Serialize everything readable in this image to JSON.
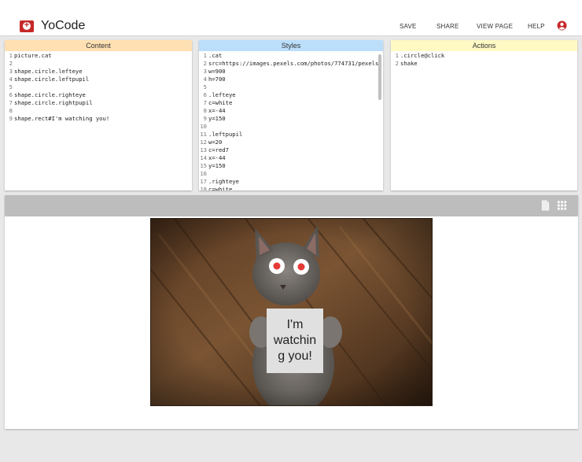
{
  "app": {
    "title": "YoCode"
  },
  "nav": [
    {
      "label": "SAVE"
    },
    {
      "label": "SHARE"
    },
    {
      "label": "VIEW PAGE"
    },
    {
      "label": "HELP"
    }
  ],
  "panels": {
    "content": {
      "title": "Content",
      "color": "#ffe0b2",
      "lines": [
        {
          "n": "1",
          "text": "picture.cat"
        },
        {
          "n": "2",
          "text": ""
        },
        {
          "n": "3",
          "text": "shape.circle.lefteye"
        },
        {
          "n": "4",
          "text": "shape.circle.leftpupil"
        },
        {
          "n": "5",
          "text": ""
        },
        {
          "n": "6",
          "text": "shape.circle.righteye"
        },
        {
          "n": "7",
          "text": "shape.circle.rightpupil"
        },
        {
          "n": "8",
          "text": ""
        },
        {
          "n": "9",
          "text": "shape.rect#I'm watching you!"
        }
      ]
    },
    "styles": {
      "title": "Styles",
      "color": "#bbdefb",
      "lines": [
        {
          "n": "1",
          "text": ".cat"
        },
        {
          "n": "2",
          "text": "src=https://images.pexels.com/photos/774731/pexels"
        },
        {
          "n": "3",
          "text": "w=900"
        },
        {
          "n": "4",
          "text": "h=700"
        },
        {
          "n": "5",
          "text": ""
        },
        {
          "n": "6",
          "text": ".lefteye"
        },
        {
          "n": "7",
          "text": "c=white"
        },
        {
          "n": "8",
          "text": "x=-44"
        },
        {
          "n": "9",
          "text": "y=150"
        },
        {
          "n": "10",
          "text": ""
        },
        {
          "n": "11",
          "text": ".leftpupil"
        },
        {
          "n": "12",
          "text": "w=20"
        },
        {
          "n": "13",
          "text": "c=red7"
        },
        {
          "n": "14",
          "text": "x=-44"
        },
        {
          "n": "15",
          "text": "y=150"
        },
        {
          "n": "16",
          "text": ""
        },
        {
          "n": "17",
          "text": ".righteye"
        },
        {
          "n": "18",
          "text": "c=white"
        }
      ]
    },
    "actions": {
      "title": "Actions",
      "color": "#fff9c4",
      "lines": [
        {
          "n": "1",
          "text": ".circle@click"
        },
        {
          "n": "2",
          "text": "shake"
        }
      ]
    }
  },
  "stage": {
    "sign_text": "I'm watching you!",
    "toolbar_color": "#bdbdbd"
  },
  "colors": {
    "brand_red": "#c62828",
    "pupil_red": "#e53935"
  }
}
